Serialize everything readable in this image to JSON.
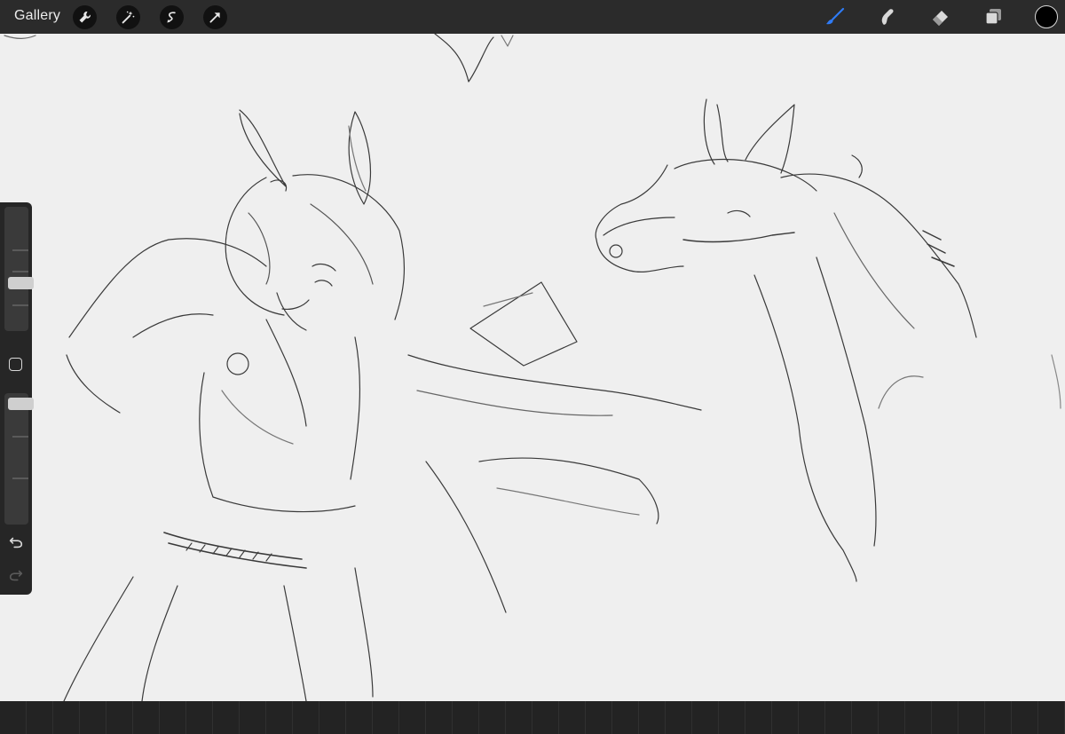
{
  "toolbar": {
    "gallery_label": "Gallery",
    "left_tools": [
      "wrench-icon",
      "magic-wand-icon",
      "selection-icon",
      "transform-arrow-icon"
    ],
    "right_tools": [
      "brush-icon",
      "smudge-icon",
      "eraser-icon",
      "layers-icon"
    ],
    "active_tool": "brush-icon",
    "accent_color": "#2f7bf5",
    "current_color": "#000000"
  },
  "sidebar": {
    "brush_size_level": 0.37,
    "opacity_level": 0.96,
    "buttons": [
      "modify-button",
      "undo-icon",
      "redo-icon"
    ]
  },
  "canvas": {
    "background": "#efefef",
    "stroke_color": "#3a3a3a"
  }
}
